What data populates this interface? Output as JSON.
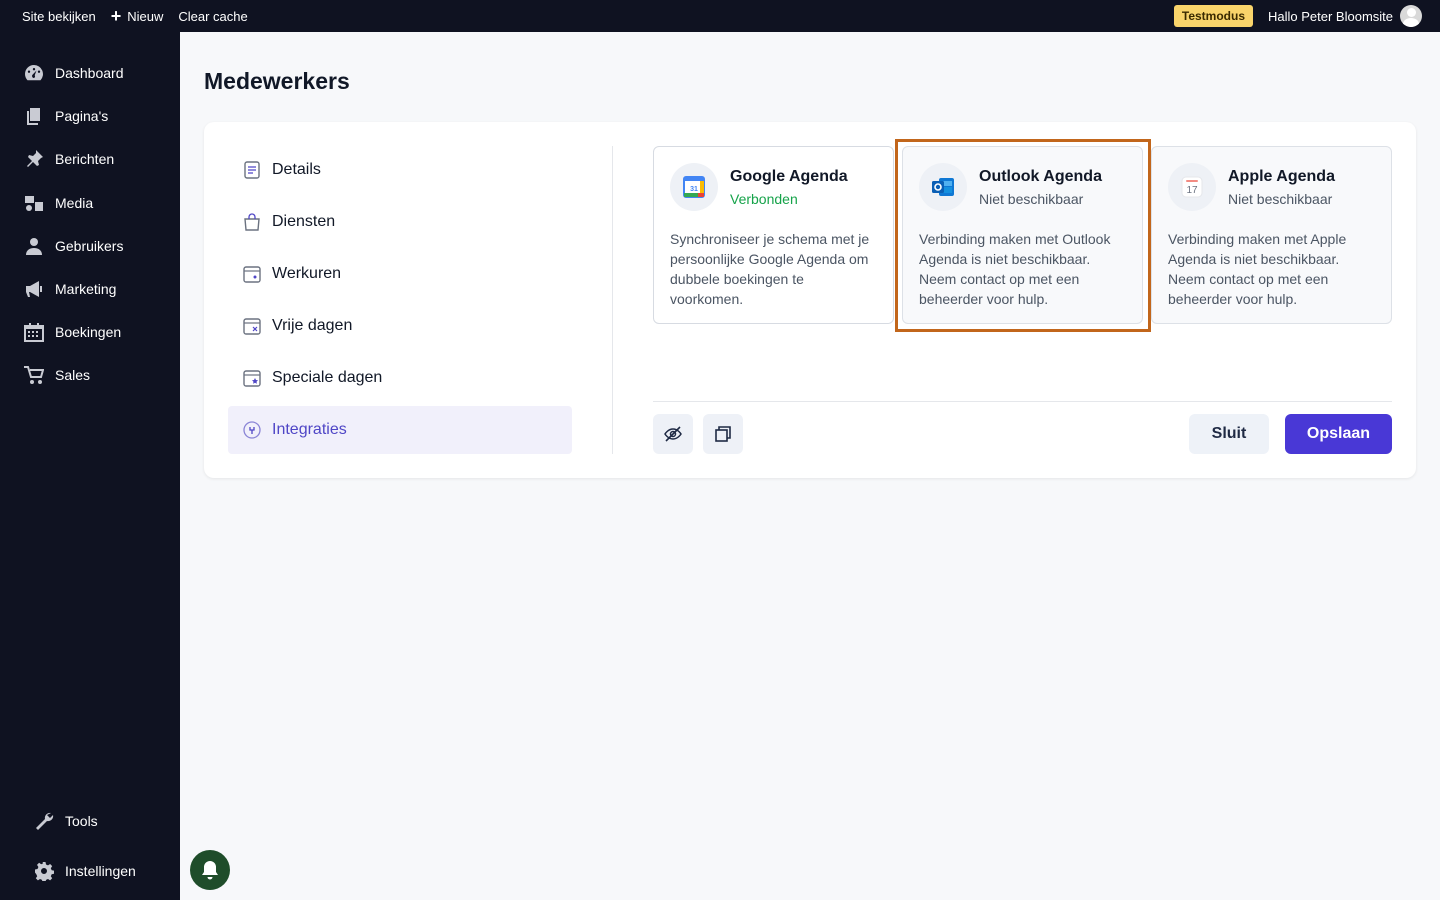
{
  "topbar": {
    "view_site": "Site bekijken",
    "new": "Nieuw",
    "clear_cache": "Clear cache",
    "test_mode": "Testmodus",
    "greeting": "Hallo Peter Bloomsite"
  },
  "sidebar": {
    "items": [
      {
        "label": "Dashboard",
        "icon": "dashboard-icon"
      },
      {
        "label": "Pagina's",
        "icon": "pages-icon"
      },
      {
        "label": "Berichten",
        "icon": "pin-icon"
      },
      {
        "label": "Media",
        "icon": "media-icon"
      },
      {
        "label": "Gebruikers",
        "icon": "user-icon"
      },
      {
        "label": "Marketing",
        "icon": "megaphone-icon"
      },
      {
        "label": "Boekingen",
        "icon": "calendar-icon"
      },
      {
        "label": "Sales",
        "icon": "cart-icon"
      }
    ],
    "bottom": [
      {
        "label": "Tools",
        "icon": "wrench-icon"
      },
      {
        "label": "Instellingen",
        "icon": "gear-icon"
      }
    ]
  },
  "page": {
    "title": "Medewerkers"
  },
  "menu": {
    "items": [
      {
        "label": "Details"
      },
      {
        "label": "Diensten"
      },
      {
        "label": "Werkuren"
      },
      {
        "label": "Vrije dagen"
      },
      {
        "label": "Speciale dagen"
      },
      {
        "label": "Integraties"
      }
    ],
    "active": "Integraties"
  },
  "integrations": [
    {
      "name": "Google Agenda",
      "status": "Verbonden",
      "description": "Synchroniseer je schema met je persoonlijke Google Agenda om dubbele boekingen te voorkomen.",
      "icon": "google-calendar-icon"
    },
    {
      "name": "Outlook Agenda",
      "status": "Niet beschikbaar",
      "description": "Verbinding maken met Outlook Agenda is niet beschikbaar. Neem contact op met een beheerder voor hulp.",
      "icon": "outlook-icon"
    },
    {
      "name": "Apple Agenda",
      "status": "Niet beschikbaar",
      "description": "Verbinding maken met Apple Agenda is niet beschikbaar. Neem contact op met een beheerder voor hulp.",
      "icon": "apple-calendar-icon"
    }
  ],
  "actions": {
    "close": "Sluit",
    "save": "Opslaan"
  },
  "colors": {
    "sidebar_bg": "#0f1221",
    "accent": "#4938d6",
    "connected": "#16a34a",
    "highlight": "#c2661b",
    "test_badge": "#f9d46b"
  }
}
